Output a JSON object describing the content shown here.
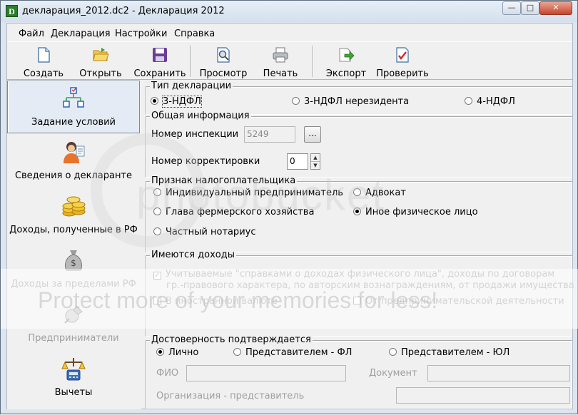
{
  "window": {
    "title": "декларация_2012.dc2 - Декларация 2012",
    "app_icon_letter": "D",
    "buttons": {
      "minimize": "—",
      "maximize": "□",
      "close": "✕"
    }
  },
  "menu": [
    "Файл",
    "Декларация",
    "Настройки",
    "Справка"
  ],
  "toolbar": [
    {
      "label": "Создать",
      "icon": "new-document-icon"
    },
    {
      "label": "Открыть",
      "icon": "open-folder-icon"
    },
    {
      "label": "Сохранить",
      "icon": "save-disk-icon"
    },
    {
      "label": "Просмотр",
      "icon": "preview-magnifier-icon"
    },
    {
      "label": "Печать",
      "icon": "printer-icon"
    },
    {
      "label": "Экспорт",
      "icon": "export-icon"
    },
    {
      "label": "Проверить",
      "icon": "check-document-icon"
    }
  ],
  "sidebar": [
    {
      "label": "Задание условий",
      "icon": "conditions-tree-icon",
      "active": true,
      "enabled": true
    },
    {
      "label": "Сведения о декларанте",
      "icon": "person-icon",
      "active": false,
      "enabled": true
    },
    {
      "label": "Доходы, полученные в РФ",
      "icon": "coins-icon",
      "active": false,
      "enabled": true
    },
    {
      "label": "Доходы за пределами РФ",
      "icon": "money-bag-icon",
      "active": false,
      "enabled": false
    },
    {
      "label": "Предприниматели",
      "icon": "entrepreneur-icon",
      "active": false,
      "enabled": false
    },
    {
      "label": "Вычеты",
      "icon": "deductions-icon",
      "active": false,
      "enabled": true
    }
  ],
  "declaration_type": {
    "title": "Тип декларации",
    "options": [
      "3-НДФЛ",
      "3-НДФЛ нерезидента",
      "4-НДФЛ"
    ],
    "selected": "3-НДФЛ"
  },
  "general_info": {
    "title": "Общая информация",
    "inspection_label": "Номер инспекции",
    "inspection_value": "5249",
    "browse_label": "...",
    "correction_label": "Номер корректировки",
    "correction_value": "0"
  },
  "taxpayer_sign": {
    "title": "Признак налогоплательщика",
    "options": [
      "Индивидуальный предприниматель",
      "Адвокат",
      "Глава фермерского хозяйства",
      "Иное физическое лицо",
      "Частный нотариус"
    ],
    "selected": "Иное физическое лицо"
  },
  "incomes": {
    "title": "Имеются доходы",
    "certified_line1": "Учитываемые \"справками о доходах физического лица\", доходы по договорам",
    "certified_line2": "гр.-правового характера, по авторским вознаграждениям, от продажи имущества и др.",
    "foreign_currency": "В иностранной валюте",
    "business": "От предпринимательской деятельности"
  },
  "reliability": {
    "title": "Достоверность подтверждается",
    "options": [
      "Лично",
      "Представителем - ФЛ",
      "Представителем - ЮЛ"
    ],
    "selected": "Лично",
    "fio_label": "ФИО",
    "document_label": "Документ",
    "org_label": "Организация - представитель"
  },
  "watermark": {
    "brand": "photobucket",
    "slogan": "Protect more of your memories for less!"
  }
}
